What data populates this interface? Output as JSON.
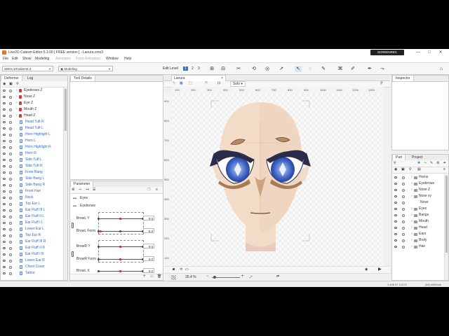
{
  "window": {
    "title": "Live2D Cubism Editor 5.3.00  [ FREE version ] - Laoura.cmo3",
    "recorder_badge": "SCREENREC",
    "controls": [
      "—",
      "□",
      "✕"
    ]
  },
  "menu": {
    "items": [
      "File",
      "Edit",
      "Show",
      "Modeling",
      "Animation",
      "Form Animation",
      "Window",
      "Help"
    ]
  },
  "toolbar": {
    "sdk_select": "SDK5.3/Cubism5.3",
    "mode_select": "Modeling",
    "edit_level_label": "Edit Level",
    "edit_levels": [
      "1",
      "2",
      "3"
    ]
  },
  "left_panel": {
    "tabs": [
      "Deformer",
      "Log"
    ],
    "rows": [
      {
        "label": "Eyebrows Z",
        "type": "group"
      },
      {
        "label": "Nose Z",
        "type": "group"
      },
      {
        "label": "Eye Z",
        "type": "group"
      },
      {
        "label": "Mouth Z",
        "type": "group"
      },
      {
        "label": "Head Z",
        "type": "group"
      },
      {
        "label": "Head Tuft R",
        "type": "item"
      },
      {
        "label": "Head Tuft L",
        "type": "item"
      },
      {
        "label": "Horn Highlight L",
        "type": "item"
      },
      {
        "label": "Horn L",
        "type": "item"
      },
      {
        "label": "Horn Highlight R",
        "type": "item"
      },
      {
        "label": "Horn R",
        "type": "item"
      },
      {
        "label": "Side Tuft L",
        "type": "item"
      },
      {
        "label": "Side Tuft R",
        "type": "item"
      },
      {
        "label": "Front Bang",
        "type": "item"
      },
      {
        "label": "Side Bang L",
        "type": "item"
      },
      {
        "label": "Side Bang R",
        "type": "item"
      },
      {
        "label": "Front Hair",
        "type": "item"
      },
      {
        "label": "Neck",
        "type": "item"
      },
      {
        "label": "Top Ear L",
        "type": "item"
      },
      {
        "label": "Ear Fluff III L",
        "type": "item"
      },
      {
        "label": "Ear Fluff II L",
        "type": "item"
      },
      {
        "label": "Ear Fluff I L",
        "type": "item"
      },
      {
        "label": "Lower Ear L",
        "type": "item"
      },
      {
        "label": "Top Ear R",
        "type": "item"
      },
      {
        "label": "Ear Fluff III R",
        "type": "item"
      },
      {
        "label": "Ear Fluff II R",
        "type": "item"
      },
      {
        "label": "Ear Fluff I R",
        "type": "item"
      },
      {
        "label": "Lower Ear R",
        "type": "item"
      },
      {
        "label": "Chest Cover",
        "type": "item"
      },
      {
        "label": "Tattoo",
        "type": "item"
      }
    ]
  },
  "tool_details": {
    "title": "Tool Details"
  },
  "parameter_panel": {
    "title": "Parameter",
    "groups": [
      "Eyes",
      "Eyebrows"
    ],
    "params": [
      {
        "name": "BrowL Y",
        "value": "0.0",
        "level": 0.5
      },
      {
        "name": "BrowL Form",
        "value": "-0.9",
        "level": 0.05
      },
      {
        "name": "BrowR Y",
        "value": "0.0",
        "level": 0.5
      },
      {
        "name": "BrowR Form",
        "value": "0.0",
        "level": 0.5
      },
      {
        "name": "BrowL X",
        "value": "0.0",
        "level": 0.5
      }
    ]
  },
  "canvas": {
    "tab_label": "Laoura",
    "solo_label": "Solo",
    "zoom": "35.4 %",
    "ruler_h": [
      "100",
      "200",
      "300",
      "400",
      "500",
      "600",
      "700",
      "800",
      "900",
      "1000",
      "1100",
      "1200",
      "1300"
    ],
    "ruler_v": [
      "900",
      "800",
      "700",
      "600",
      "500",
      "400",
      "300",
      "200",
      "100",
      "0",
      "-100"
    ]
  },
  "inspector": {
    "title": "Inspector"
  },
  "part_panel": {
    "tabs": [
      "Part",
      "Project"
    ],
    "rows": [
      {
        "label": "Horns",
        "expandable": true
      },
      {
        "label": "Eyebrows",
        "expandable": true
      },
      {
        "label": "Nose Z",
        "expandable": true
      },
      {
        "label": "Nose xy",
        "expandable": true
      },
      {
        "label": "Nose",
        "expandable": false
      },
      {
        "label": "Eyes",
        "expandable": true
      },
      {
        "label": "Bangs",
        "expandable": true
      },
      {
        "label": "Mouth",
        "expandable": true
      },
      {
        "label": "Head",
        "expandable": true
      },
      {
        "label": "Ears",
        "expandable": true
      },
      {
        "label": "Body",
        "expandable": true
      },
      {
        "label": "Hair",
        "expandable": true
      }
    ]
  },
  "status": {
    "coords": "1,408.97  115.37",
    "bitrate": "[##] bit/Mode"
  },
  "colors": {
    "accent": "#2f6cc9",
    "skin": "#f2dcc7",
    "eye_blue": "#3e63c6",
    "horn_brown": "#a27652"
  }
}
